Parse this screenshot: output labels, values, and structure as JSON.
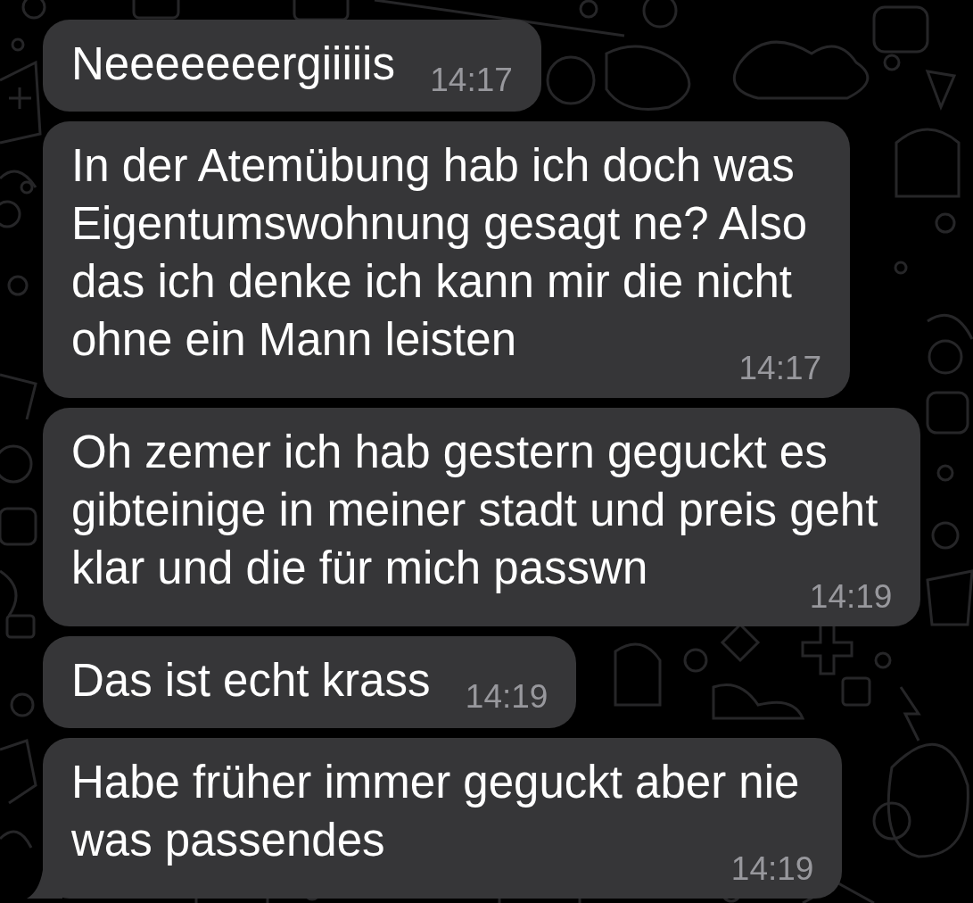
{
  "messages": [
    {
      "text": "Neeeeeeergiiiiis",
      "time": "14:17",
      "tail": false
    },
    {
      "text": "In der Atemübung hab ich doch was\nEigentumswohnung gesagt ne? Also\ndas ich denke ich kann mir die nicht\nohne ein Mann leisten",
      "time": "14:17",
      "tail": false
    },
    {
      "text": "Oh zemer ich hab gestern geguckt es\ngibteinige in meiner stadt und preis geht\nklar und die für mich passwn",
      "time": "14:19",
      "tail": false
    },
    {
      "text": "Das ist echt krass",
      "time": "14:19",
      "tail": false
    },
    {
      "text": "Habe früher immer geguckt aber nie\nwas passendes",
      "time": "14:19",
      "tail": true
    }
  ]
}
